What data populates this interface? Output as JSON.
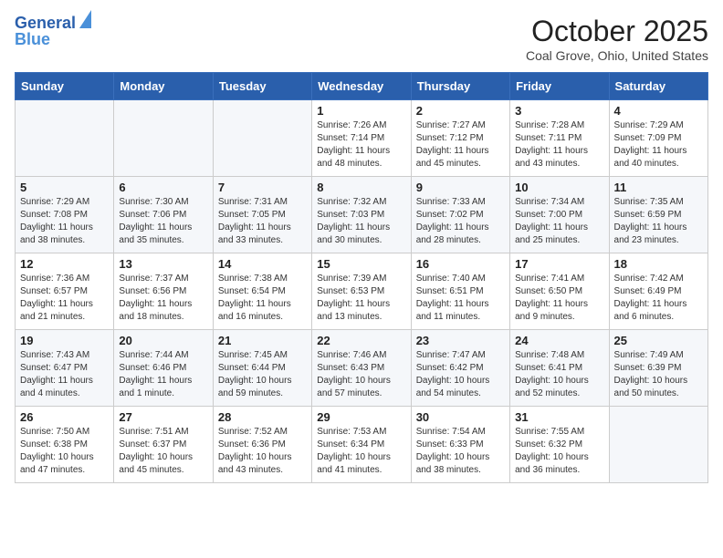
{
  "header": {
    "logo_line1": "General",
    "logo_line2": "Blue",
    "month_title": "October 2025",
    "location": "Coal Grove, Ohio, United States"
  },
  "weekdays": [
    "Sunday",
    "Monday",
    "Tuesday",
    "Wednesday",
    "Thursday",
    "Friday",
    "Saturday"
  ],
  "weeks": [
    [
      {
        "day": "",
        "text": ""
      },
      {
        "day": "",
        "text": ""
      },
      {
        "day": "",
        "text": ""
      },
      {
        "day": "1",
        "text": "Sunrise: 7:26 AM\nSunset: 7:14 PM\nDaylight: 11 hours and 48 minutes."
      },
      {
        "day": "2",
        "text": "Sunrise: 7:27 AM\nSunset: 7:12 PM\nDaylight: 11 hours and 45 minutes."
      },
      {
        "day": "3",
        "text": "Sunrise: 7:28 AM\nSunset: 7:11 PM\nDaylight: 11 hours and 43 minutes."
      },
      {
        "day": "4",
        "text": "Sunrise: 7:29 AM\nSunset: 7:09 PM\nDaylight: 11 hours and 40 minutes."
      }
    ],
    [
      {
        "day": "5",
        "text": "Sunrise: 7:29 AM\nSunset: 7:08 PM\nDaylight: 11 hours and 38 minutes."
      },
      {
        "day": "6",
        "text": "Sunrise: 7:30 AM\nSunset: 7:06 PM\nDaylight: 11 hours and 35 minutes."
      },
      {
        "day": "7",
        "text": "Sunrise: 7:31 AM\nSunset: 7:05 PM\nDaylight: 11 hours and 33 minutes."
      },
      {
        "day": "8",
        "text": "Sunrise: 7:32 AM\nSunset: 7:03 PM\nDaylight: 11 hours and 30 minutes."
      },
      {
        "day": "9",
        "text": "Sunrise: 7:33 AM\nSunset: 7:02 PM\nDaylight: 11 hours and 28 minutes."
      },
      {
        "day": "10",
        "text": "Sunrise: 7:34 AM\nSunset: 7:00 PM\nDaylight: 11 hours and 25 minutes."
      },
      {
        "day": "11",
        "text": "Sunrise: 7:35 AM\nSunset: 6:59 PM\nDaylight: 11 hours and 23 minutes."
      }
    ],
    [
      {
        "day": "12",
        "text": "Sunrise: 7:36 AM\nSunset: 6:57 PM\nDaylight: 11 hours and 21 minutes."
      },
      {
        "day": "13",
        "text": "Sunrise: 7:37 AM\nSunset: 6:56 PM\nDaylight: 11 hours and 18 minutes."
      },
      {
        "day": "14",
        "text": "Sunrise: 7:38 AM\nSunset: 6:54 PM\nDaylight: 11 hours and 16 minutes."
      },
      {
        "day": "15",
        "text": "Sunrise: 7:39 AM\nSunset: 6:53 PM\nDaylight: 11 hours and 13 minutes."
      },
      {
        "day": "16",
        "text": "Sunrise: 7:40 AM\nSunset: 6:51 PM\nDaylight: 11 hours and 11 minutes."
      },
      {
        "day": "17",
        "text": "Sunrise: 7:41 AM\nSunset: 6:50 PM\nDaylight: 11 hours and 9 minutes."
      },
      {
        "day": "18",
        "text": "Sunrise: 7:42 AM\nSunset: 6:49 PM\nDaylight: 11 hours and 6 minutes."
      }
    ],
    [
      {
        "day": "19",
        "text": "Sunrise: 7:43 AM\nSunset: 6:47 PM\nDaylight: 11 hours and 4 minutes."
      },
      {
        "day": "20",
        "text": "Sunrise: 7:44 AM\nSunset: 6:46 PM\nDaylight: 11 hours and 1 minute."
      },
      {
        "day": "21",
        "text": "Sunrise: 7:45 AM\nSunset: 6:44 PM\nDaylight: 10 hours and 59 minutes."
      },
      {
        "day": "22",
        "text": "Sunrise: 7:46 AM\nSunset: 6:43 PM\nDaylight: 10 hours and 57 minutes."
      },
      {
        "day": "23",
        "text": "Sunrise: 7:47 AM\nSunset: 6:42 PM\nDaylight: 10 hours and 54 minutes."
      },
      {
        "day": "24",
        "text": "Sunrise: 7:48 AM\nSunset: 6:41 PM\nDaylight: 10 hours and 52 minutes."
      },
      {
        "day": "25",
        "text": "Sunrise: 7:49 AM\nSunset: 6:39 PM\nDaylight: 10 hours and 50 minutes."
      }
    ],
    [
      {
        "day": "26",
        "text": "Sunrise: 7:50 AM\nSunset: 6:38 PM\nDaylight: 10 hours and 47 minutes."
      },
      {
        "day": "27",
        "text": "Sunrise: 7:51 AM\nSunset: 6:37 PM\nDaylight: 10 hours and 45 minutes."
      },
      {
        "day": "28",
        "text": "Sunrise: 7:52 AM\nSunset: 6:36 PM\nDaylight: 10 hours and 43 minutes."
      },
      {
        "day": "29",
        "text": "Sunrise: 7:53 AM\nSunset: 6:34 PM\nDaylight: 10 hours and 41 minutes."
      },
      {
        "day": "30",
        "text": "Sunrise: 7:54 AM\nSunset: 6:33 PM\nDaylight: 10 hours and 38 minutes."
      },
      {
        "day": "31",
        "text": "Sunrise: 7:55 AM\nSunset: 6:32 PM\nDaylight: 10 hours and 36 minutes."
      },
      {
        "day": "",
        "text": ""
      }
    ]
  ]
}
